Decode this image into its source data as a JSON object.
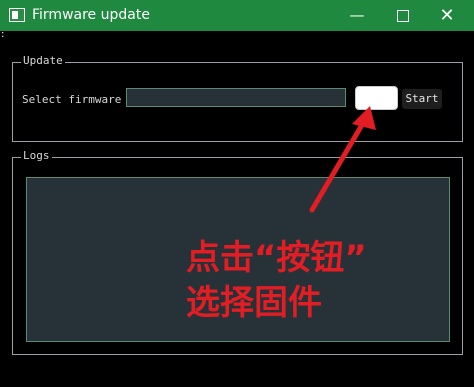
{
  "window": {
    "title": "Firmware update",
    "controls": {
      "minimize": "—",
      "close": "✕"
    }
  },
  "menu_indicator": ":",
  "update_group": {
    "title": "Update",
    "select_label": "Select firmware",
    "firmware_path_value": "",
    "browse_button_label": "",
    "start_button_label": "Start"
  },
  "logs_group": {
    "title": "Logs",
    "log_content": ""
  },
  "annotation": {
    "line1": "点击“按钮”",
    "line2": "选择固件",
    "color": "#e21d24"
  },
  "colors": {
    "titlebar": "#1f8a3f",
    "background": "#000000",
    "field": "#263238"
  }
}
